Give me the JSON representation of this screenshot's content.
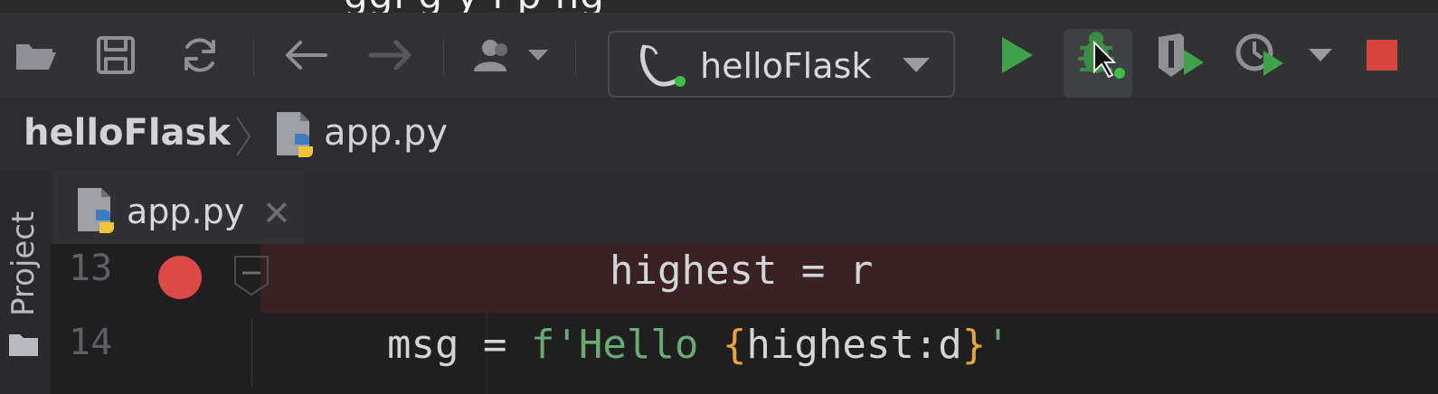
{
  "caption_partial": "ggi g  y  i   p    ng",
  "toolbar": {
    "items": [
      "open-folder",
      "save-all",
      "sync",
      "back",
      "forward",
      "vcs-user"
    ],
    "run_config": "helloFlask",
    "colors": {
      "run": "#3fa24a",
      "stop": "#e03a3a",
      "accent": "#3d8ee0"
    }
  },
  "breadcrumb": {
    "root": "helloFlask",
    "file": "app.py"
  },
  "sidebar": {
    "project_label": "Project"
  },
  "tabs": [
    {
      "label": "app.py",
      "active": true
    }
  ],
  "editor": {
    "lines": [
      {
        "number": "13",
        "code": "highest = r",
        "breakpoint": true
      },
      {
        "number": "14",
        "code_parts": [
          "msg = ",
          "f'Hello ",
          "{",
          "highest:d",
          "}",
          "'"
        ],
        "breakpoint": false
      }
    ]
  }
}
